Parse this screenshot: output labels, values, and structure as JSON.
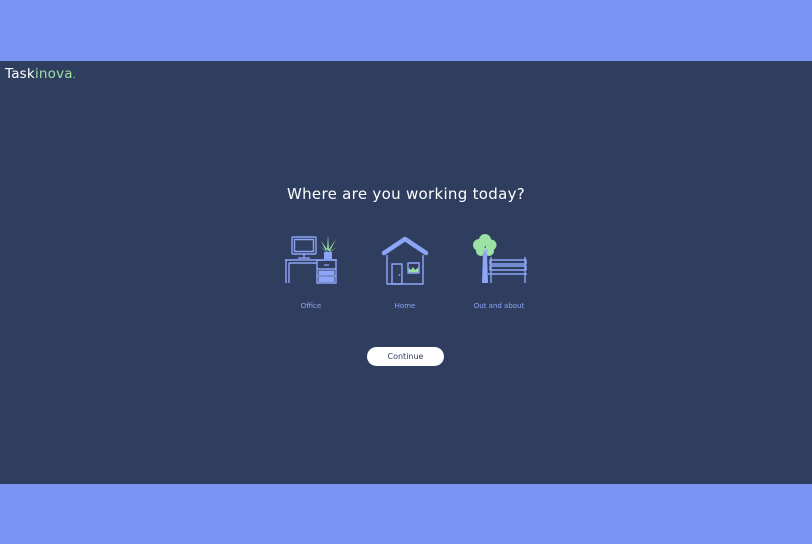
{
  "brand": {
    "part1": "Task",
    "part2": "inova",
    "dot": "."
  },
  "prompt": {
    "title": "Where are you working today?"
  },
  "options": [
    {
      "label": "Office",
      "icon": "office-desk-icon"
    },
    {
      "label": "Home",
      "icon": "house-icon"
    },
    {
      "label": "Out and about",
      "icon": "park-tree-bench-icon"
    }
  ],
  "actions": {
    "continue_label": "Continue"
  },
  "colors": {
    "page_band": "#7b93f3",
    "stage_bg": "#2f3e5e",
    "accent_blue": "#8ea5f7",
    "accent_green": "#9be2a4",
    "button_bg": "#ffffff"
  }
}
